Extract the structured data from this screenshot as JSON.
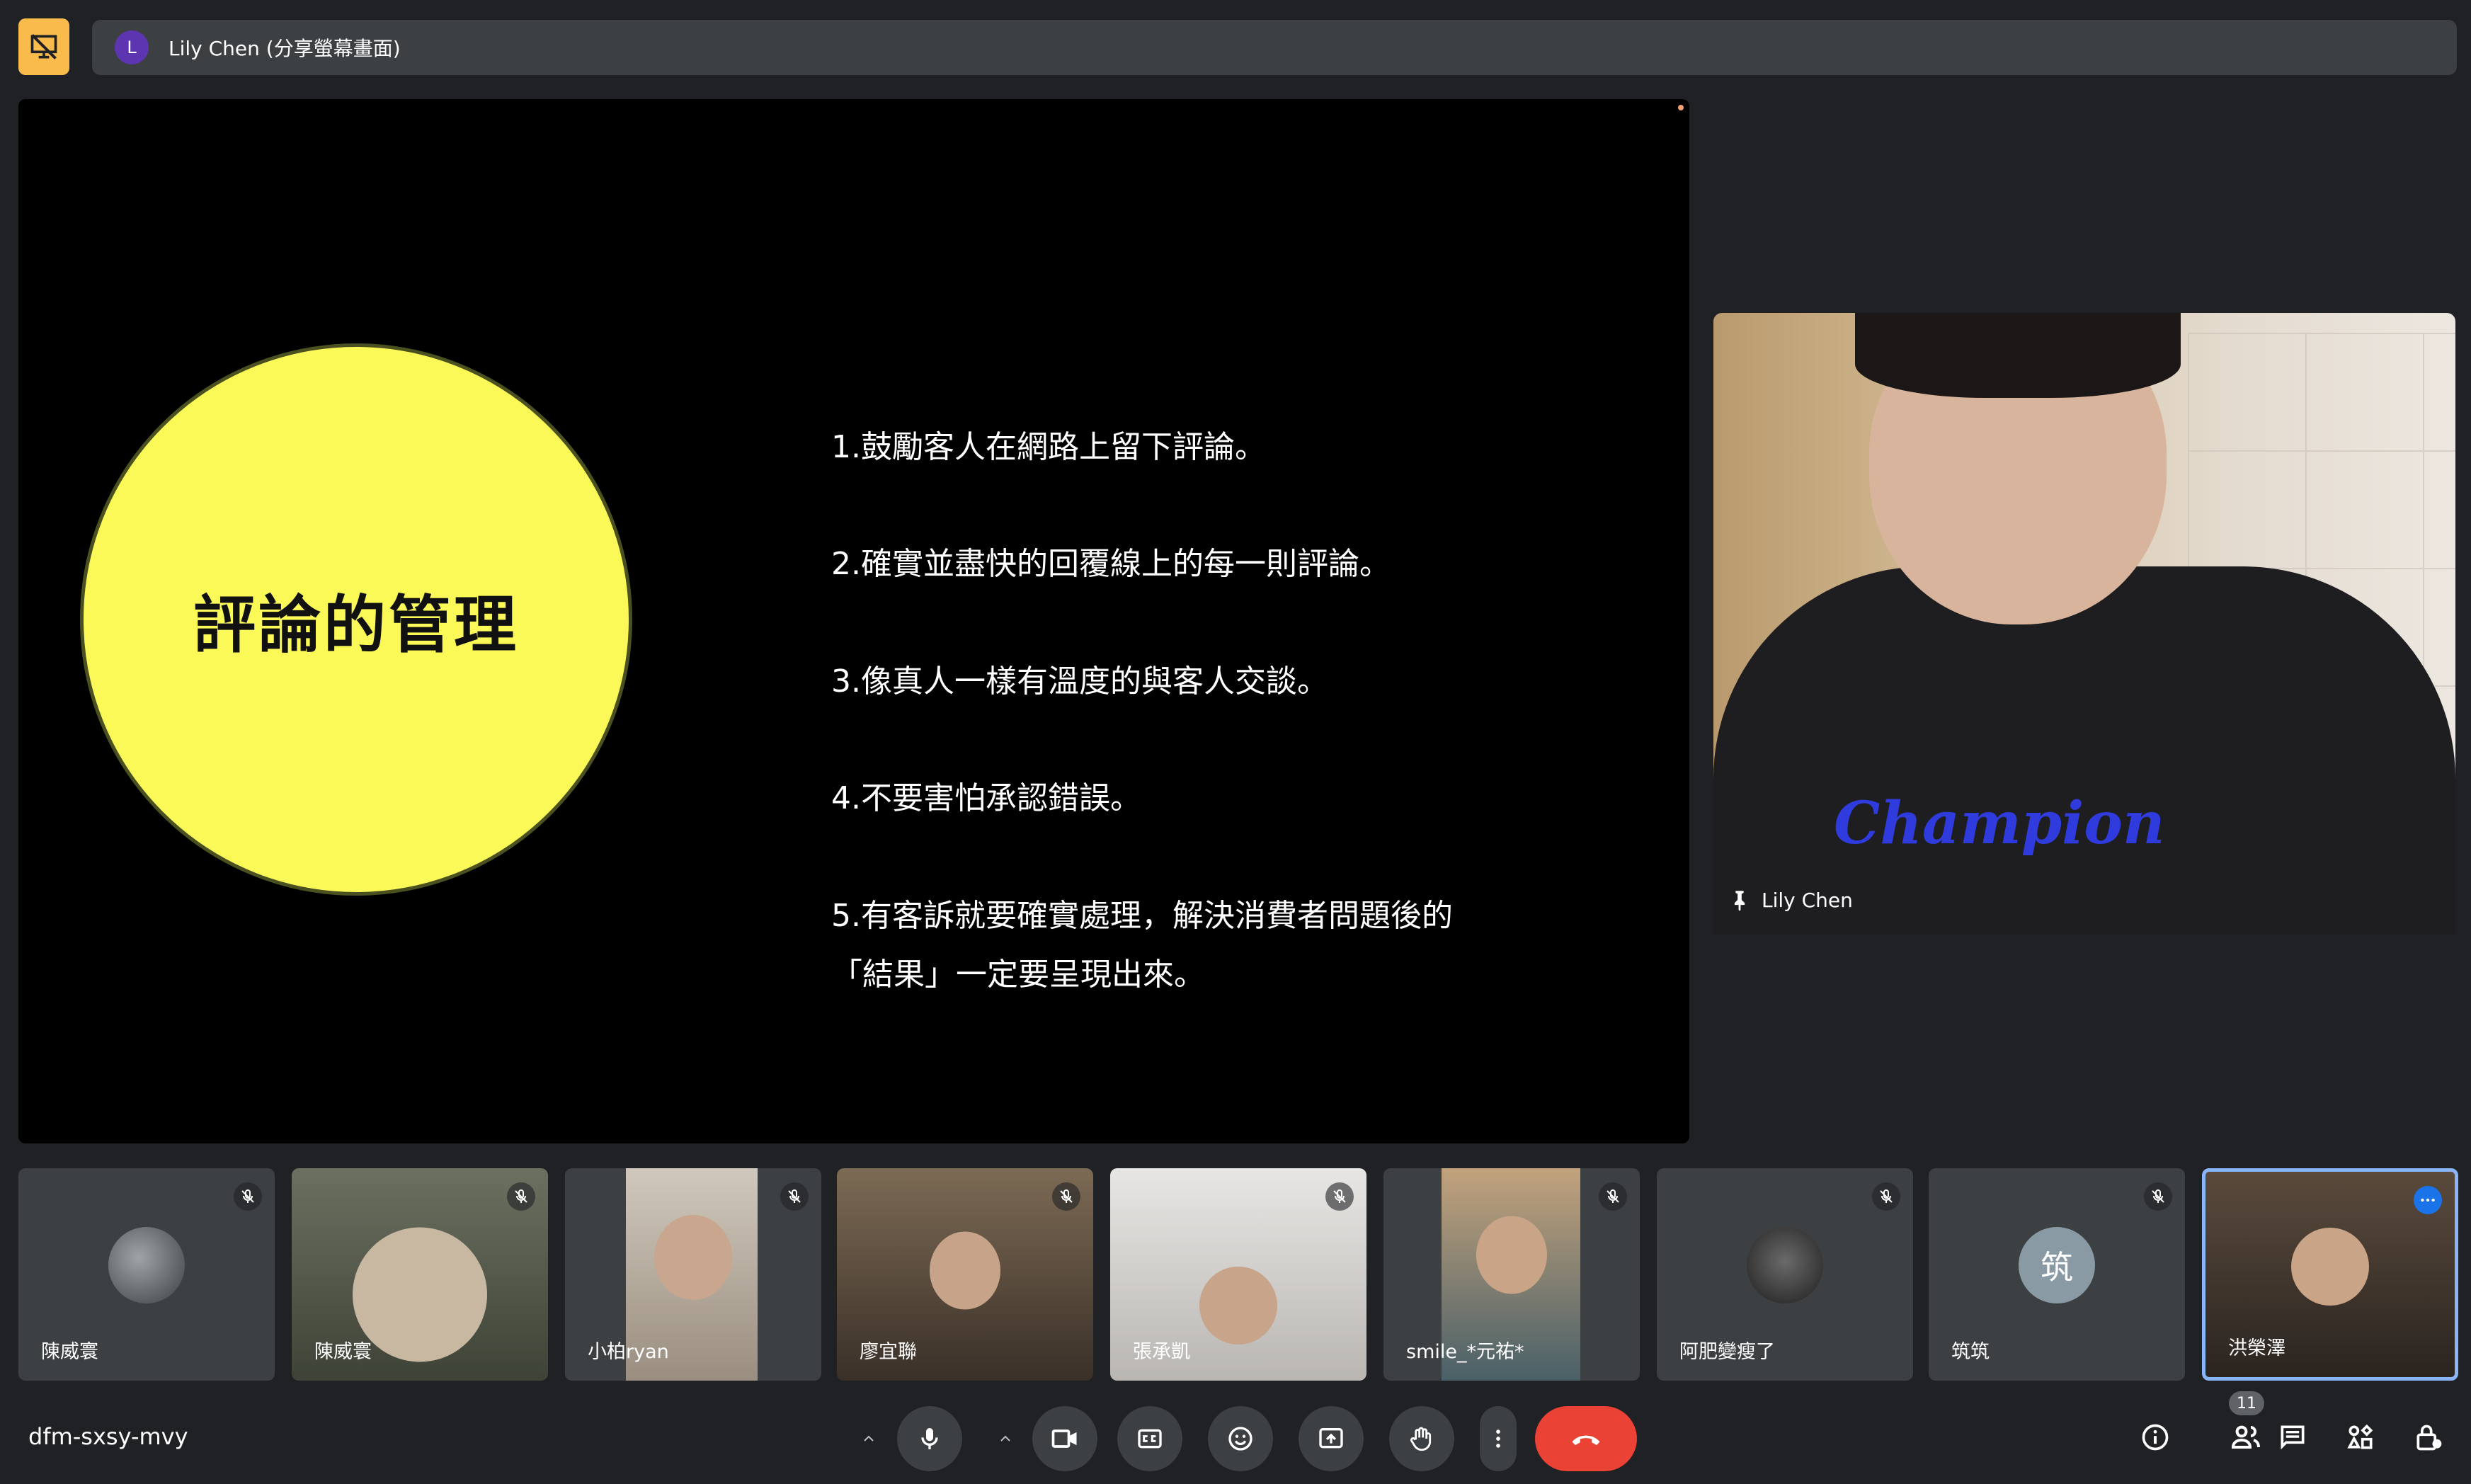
{
  "presenter_bar": {
    "avatar_letter": "L",
    "label": "Lily Chen (分享螢幕畫面)"
  },
  "slide": {
    "title": "評論的管理",
    "points": [
      "1.鼓勵客人在網路上留下評論。",
      "2.確實並盡快的回覆線上的每一則評論。",
      "3.像真人一樣有溫度的與客人交談。",
      "4.不要害怕承認錯誤。",
      "5.有客訴就要確實處理，解決消費者問題後的",
      "「結果」一定要呈現出來。"
    ]
  },
  "pinned": {
    "name": "Lily Chen",
    "shirt_text": "Champion"
  },
  "participants": [
    {
      "name": "陳威寰"
    },
    {
      "name": "陳威寰"
    },
    {
      "name": "小柏ryan"
    },
    {
      "name": "廖宜聯"
    },
    {
      "name": "張承凱"
    },
    {
      "name": "smile_*元祐*"
    },
    {
      "name": "阿肥變瘦了"
    },
    {
      "name": "筑筑",
      "initial": "筑"
    },
    {
      "name": "洪榮澤"
    }
  ],
  "meeting": {
    "code": "dfm-sxsy-mvy",
    "participant_count": "11"
  },
  "colors": {
    "hangup": "#ea4335",
    "accent": "#8ab4f8",
    "badge": "#f9bb4b",
    "slide_circle": "#fbf958"
  }
}
